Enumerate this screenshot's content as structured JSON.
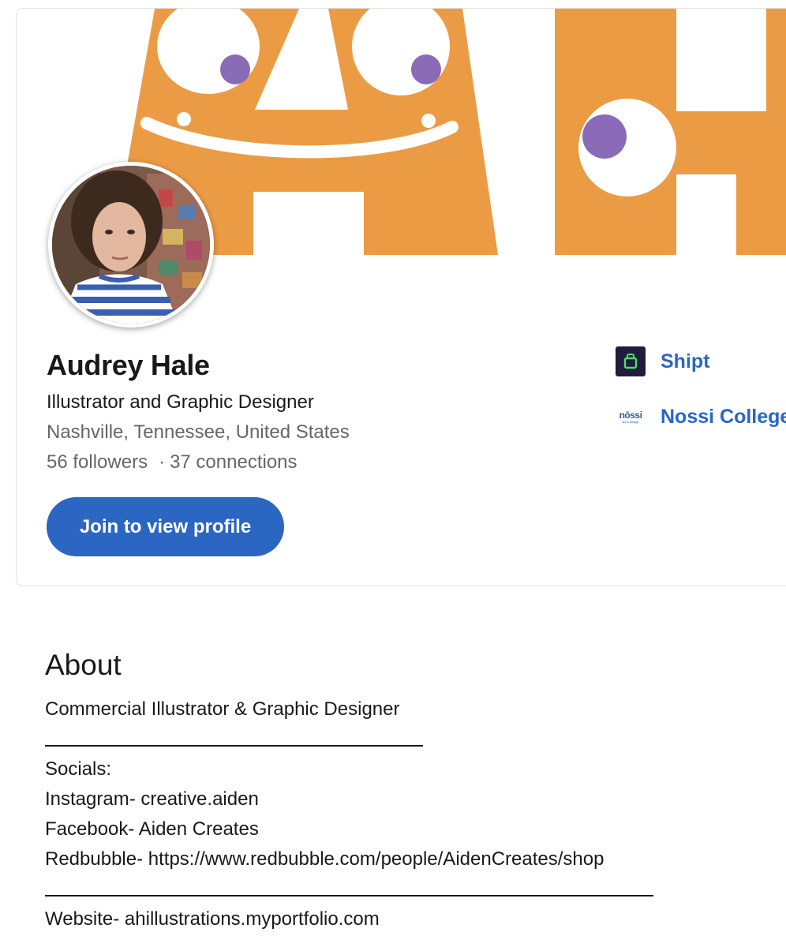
{
  "profile": {
    "name": "Audrey Hale",
    "headline": "Illustrator and Graphic Designer",
    "location": "Nashville, Tennessee, United States",
    "followers": "56 followers",
    "separator": "·",
    "connections": "37 connections",
    "join_label": "Join to view profile"
  },
  "companies": [
    {
      "label": "Shipt",
      "icon": "shipt-bag-icon"
    },
    {
      "label": "Nossi College",
      "logo_text": "nōssi",
      "logo_sub": "art & design",
      "icon": "nossi-logo"
    }
  ],
  "about": {
    "title": "About",
    "lines": [
      "Commercial Illustrator & Graphic Designer",
      "Socials:",
      "Instagram- creative.aiden",
      "Facebook- Aiden Creates",
      "Redbubble- https://www.redbubble.com/people/AidenCreates/shop",
      "Website- ahillustrations.myportfolio.com"
    ]
  },
  "colors": {
    "banner_orange": "#ec9b45",
    "eye_purple": "#8a6bb8",
    "link_blue": "#2b66c2",
    "button_blue": "#2b66c2",
    "muted_text": "#666666"
  }
}
